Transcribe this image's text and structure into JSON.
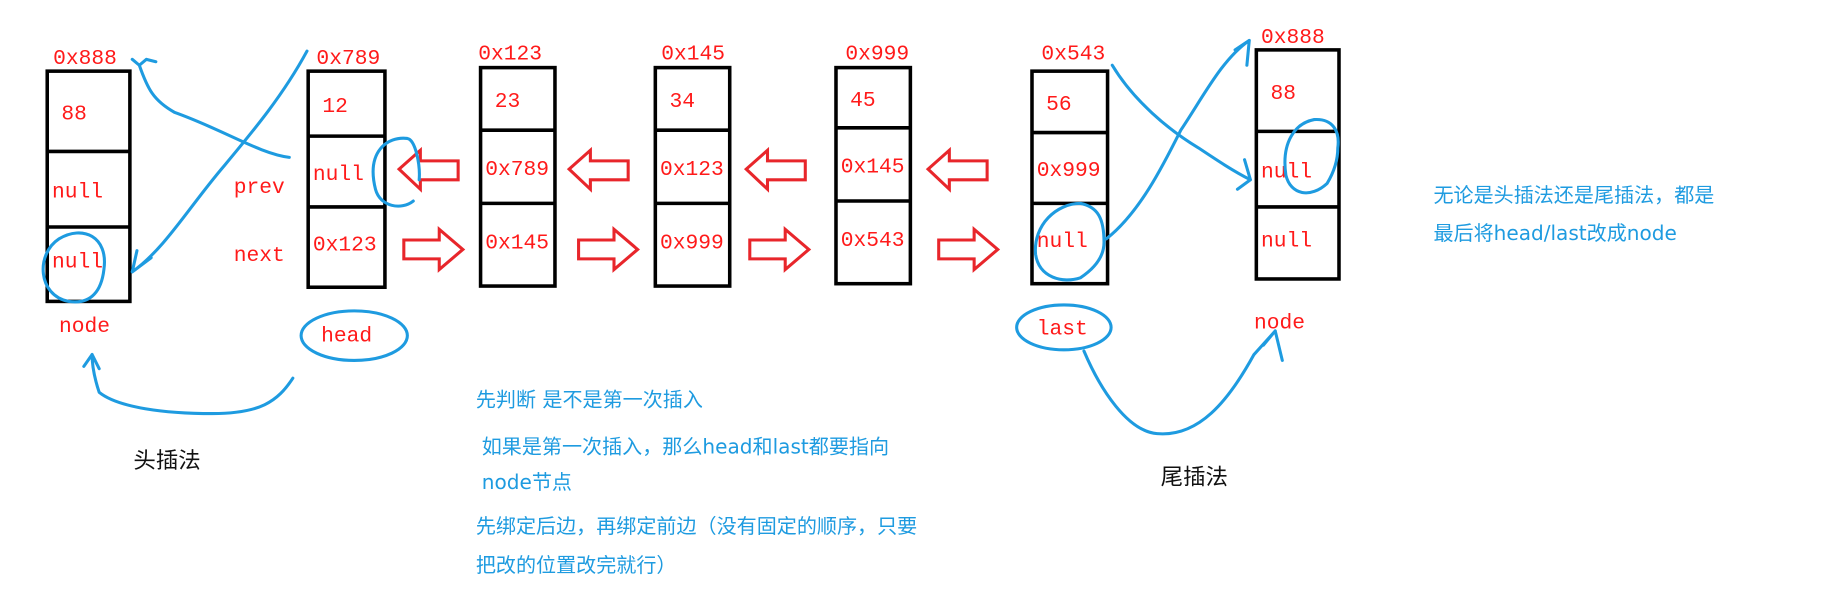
{
  "colors": {
    "text_red": "#ff1a1a",
    "annotation_blue": "#1e9be0",
    "arrow_red": "#e8262b",
    "box": "#000000"
  },
  "field_labels": {
    "prev": "prev",
    "next": "next"
  },
  "head_insert": {
    "title": "头插法",
    "new_node": {
      "address": "0x888",
      "data": "88",
      "prev": "null",
      "next": "null",
      "caption": "node"
    }
  },
  "list": [
    {
      "address": "0x789",
      "data": "12",
      "prev": "null",
      "next": "0x123"
    },
    {
      "address": "0x123",
      "data": "23",
      "prev": "0x789",
      "next": "0x145"
    },
    {
      "address": "0x145",
      "data": "34",
      "prev": "0x123",
      "next": "0x999"
    },
    {
      "address": "0x999",
      "data": "45",
      "prev": "0x145",
      "next": "0x543"
    },
    {
      "address": "0x543",
      "data": "56",
      "prev": "0x999",
      "next": "null"
    }
  ],
  "pointers": {
    "head": "head",
    "last": "last"
  },
  "tail_insert": {
    "title": "尾插法",
    "new_node": {
      "address": "0x888",
      "data": "88",
      "prev": "null",
      "next": "null",
      "caption": "node"
    }
  },
  "notes": {
    "line1": "先判断 是不是第一次插入",
    "line2": "如果是第一次插入，那么head和last都要指向",
    "line3": "node节点",
    "line4": "先绑定后边，再绑定前边（没有固定的顺序，只要",
    "line5": "把改的位置改完就行）"
  },
  "summary": {
    "line1": "无论是头插法还是尾插法，都是",
    "line2": "最后将head/last改成node"
  }
}
